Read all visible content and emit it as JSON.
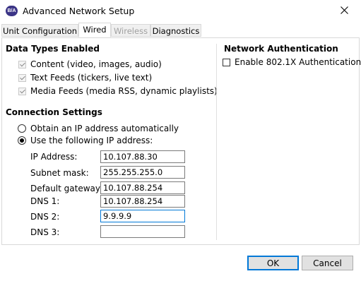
{
  "window": {
    "title": "Advanced Network Setup",
    "app_icon_text": "B/A"
  },
  "tabs": [
    {
      "label": "Unit Configuration",
      "state": "normal"
    },
    {
      "label": "Wired",
      "state": "active"
    },
    {
      "label": "Wireless",
      "state": "disabled"
    },
    {
      "label": "Diagnostics",
      "state": "normal"
    }
  ],
  "data_types": {
    "title": "Data Types Enabled",
    "items": [
      {
        "label": "Content (video, images, audio)",
        "checked": true
      },
      {
        "label": "Text Feeds (tickers, live text)",
        "checked": true
      },
      {
        "label": "Media Feeds (media RSS, dynamic playlists)",
        "checked": true
      }
    ]
  },
  "connection": {
    "title": "Connection Settings",
    "options": [
      {
        "label": "Obtain an IP address automatically",
        "selected": false
      },
      {
        "label": "Use the following IP address:",
        "selected": true
      }
    ],
    "fields": [
      {
        "label": "IP Address:",
        "value": "10.107.88.30"
      },
      {
        "label": "Subnet mask:",
        "value": "255.255.255.0"
      },
      {
        "label": "Default gateway:",
        "value": "10.107.88.254"
      },
      {
        "label": "DNS 1:",
        "value": "10.107.88.254"
      },
      {
        "label": "DNS 2:",
        "value": "9.9.9.9"
      },
      {
        "label": "DNS 3:",
        "value": ""
      }
    ]
  },
  "network_auth": {
    "title": "Network Authentication",
    "option": {
      "label": "Enable 802.1X Authentication",
      "checked": false
    }
  },
  "buttons": {
    "ok": "OK",
    "cancel": "Cancel"
  },
  "colors": {
    "accent": "#0078d7",
    "app_icon_bg": "#3b3486"
  }
}
